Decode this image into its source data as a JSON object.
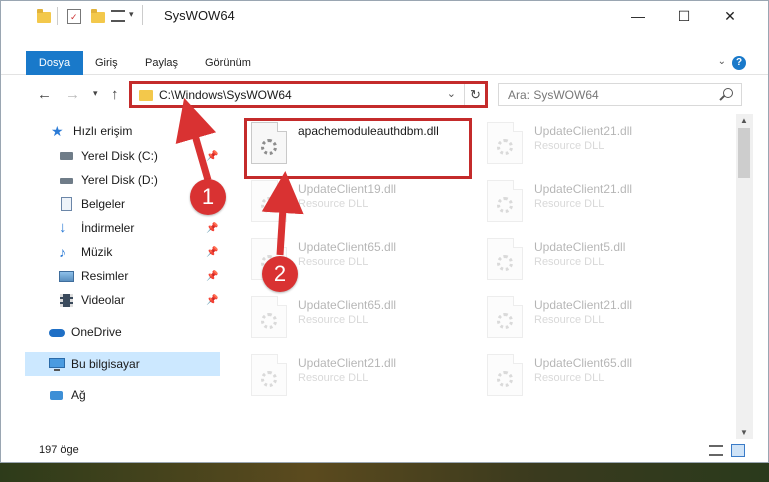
{
  "window": {
    "title": "SysWOW64",
    "controls": {
      "minimize": "—",
      "maximize": "☐",
      "close": "✕"
    }
  },
  "ribbon": {
    "tabs": [
      "Dosya",
      "Giriş",
      "Paylaş",
      "Görünüm"
    ],
    "help": "?"
  },
  "nav": {
    "address": "C:\\Windows\\SysWOW64",
    "search_placeholder": "Ara: SysWOW64"
  },
  "sidebar": {
    "quick_access": "Hızlı erişim",
    "items": [
      {
        "label": "Yerel Disk (C:)",
        "icon": "drive-icon",
        "pinned": true
      },
      {
        "label": "Yerel Disk (D:)",
        "icon": "drive-icon",
        "pinned": false
      },
      {
        "label": "Belgeler",
        "icon": "documents-icon",
        "pinned": true
      },
      {
        "label": "İndirmeler",
        "icon": "download-icon",
        "pinned": true
      },
      {
        "label": "Müzik",
        "icon": "music-icon",
        "pinned": true
      },
      {
        "label": "Resimler",
        "icon": "pictures-icon",
        "pinned": true
      },
      {
        "label": "Videolar",
        "icon": "videos-icon",
        "pinned": true
      }
    ],
    "onedrive": "OneDrive",
    "this_pc": "Bu bilgisayar",
    "network": "Ağ"
  },
  "files": {
    "selected": {
      "name": "apachemoduleauthdbm.dll",
      "type": ""
    },
    "left_column": [
      {
        "name": "UpdateClient19.dll",
        "type": "Resource DLL"
      },
      {
        "name": "UpdateClient65.dll",
        "type": "Resource DLL"
      },
      {
        "name": "UpdateClient65.dll",
        "type": "Resource DLL"
      },
      {
        "name": "UpdateClient21.dll",
        "type": "Resource DLL"
      }
    ],
    "right_column": [
      {
        "name": "UpdateClient21.dll",
        "type": "Resource DLL"
      },
      {
        "name": "UpdateClient21.dll",
        "type": "Resource DLL"
      },
      {
        "name": "UpdateClient5.dll",
        "type": "Resource DLL"
      },
      {
        "name": "UpdateClient21.dll",
        "type": "Resource DLL"
      },
      {
        "name": "UpdateClient65.dll",
        "type": "Resource DLL"
      }
    ]
  },
  "status": {
    "count": "197 öge"
  },
  "annotations": {
    "step1": "1",
    "step2": "2",
    "color": "#d93232"
  }
}
